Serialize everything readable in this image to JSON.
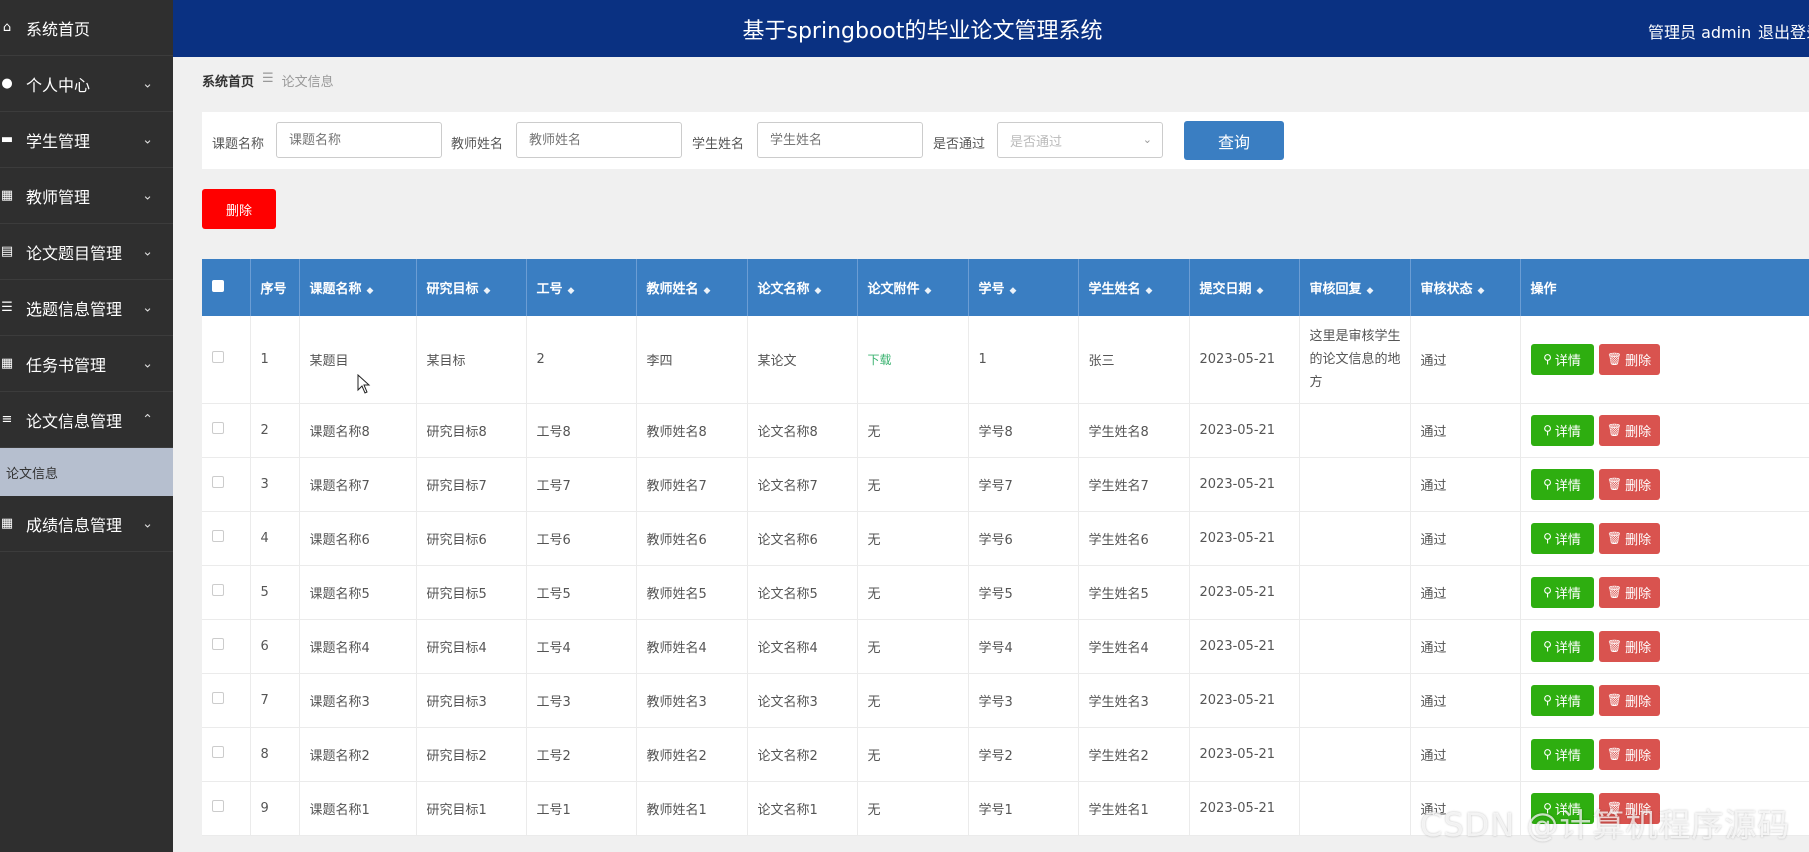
{
  "header": {
    "title": "基于springboot的毕业论文管理系统",
    "user": "管理员 admin",
    "logout": "退出登录"
  },
  "sidebar": {
    "items": [
      {
        "label": "系统首页",
        "icon": "home-icon",
        "has_chevron": false
      },
      {
        "label": "个人中心",
        "icon": "user-icon",
        "has_chevron": true,
        "chevron": "⌄"
      },
      {
        "label": "学生管理",
        "icon": "briefcase-icon",
        "has_chevron": true,
        "chevron": "⌄"
      },
      {
        "label": "教师管理",
        "icon": "grid-icon",
        "has_chevron": true,
        "chevron": "⌄"
      },
      {
        "label": "论文题目管理",
        "icon": "clipboard-icon",
        "has_chevron": true,
        "chevron": "⌄"
      },
      {
        "label": "选题信息管理",
        "icon": "list-icon",
        "has_chevron": true,
        "chevron": "⌄"
      },
      {
        "label": "任务书管理",
        "icon": "grid-icon",
        "has_chevron": true,
        "chevron": "⌄"
      },
      {
        "label": "论文信息管理",
        "icon": "sliders-icon",
        "has_chevron": true,
        "chevron": "⌃",
        "expanded": true
      },
      {
        "label": "成绩信息管理",
        "icon": "grid-icon",
        "has_chevron": true,
        "chevron": "⌄"
      }
    ],
    "sub_item": "论文信息"
  },
  "breadcrumb": {
    "home": "系统首页",
    "sep": "☰",
    "current": "论文信息"
  },
  "search": {
    "topic_label": "课题名称",
    "topic_placeholder": "课题名称",
    "teacher_label": "教师姓名",
    "teacher_placeholder": "教师姓名",
    "student_label": "学生姓名",
    "student_placeholder": "学生姓名",
    "pass_label": "是否通过",
    "pass_placeholder": "是否通过",
    "button": "查询"
  },
  "delete_button": "删除",
  "table": {
    "columns": [
      "序号",
      "课题名称",
      "研究目标",
      "工号",
      "教师姓名",
      "论文名称",
      "论文附件",
      "学号",
      "学生姓名",
      "提交日期",
      "审核回复",
      "审核状态",
      "操作"
    ],
    "detail_label": "详情",
    "delete_label": "删除",
    "rows": [
      {
        "no": "1",
        "topic": "某题目",
        "goal": "某目标",
        "job_no": "2",
        "teacher": "李四",
        "thesis": "某论文",
        "attachment": "下载",
        "student_no": "1",
        "student": "张三",
        "date": "2023-05-21",
        "reply": "这里是审核学生的论文信息的地方",
        "status": "通过"
      },
      {
        "no": "2",
        "topic": "课题名称8",
        "goal": "研究目标8",
        "job_no": "工号8",
        "teacher": "教师姓名8",
        "thesis": "论文名称8",
        "attachment": "无",
        "student_no": "学号8",
        "student": "学生姓名8",
        "date": "2023-05-21",
        "reply": "",
        "status": "通过"
      },
      {
        "no": "3",
        "topic": "课题名称7",
        "goal": "研究目标7",
        "job_no": "工号7",
        "teacher": "教师姓名7",
        "thesis": "论文名称7",
        "attachment": "无",
        "student_no": "学号7",
        "student": "学生姓名7",
        "date": "2023-05-21",
        "reply": "",
        "status": "通过"
      },
      {
        "no": "4",
        "topic": "课题名称6",
        "goal": "研究目标6",
        "job_no": "工号6",
        "teacher": "教师姓名6",
        "thesis": "论文名称6",
        "attachment": "无",
        "student_no": "学号6",
        "student": "学生姓名6",
        "date": "2023-05-21",
        "reply": "",
        "status": "通过"
      },
      {
        "no": "5",
        "topic": "课题名称5",
        "goal": "研究目标5",
        "job_no": "工号5",
        "teacher": "教师姓名5",
        "thesis": "论文名称5",
        "attachment": "无",
        "student_no": "学号5",
        "student": "学生姓名5",
        "date": "2023-05-21",
        "reply": "",
        "status": "通过"
      },
      {
        "no": "6",
        "topic": "课题名称4",
        "goal": "研究目标4",
        "job_no": "工号4",
        "teacher": "教师姓名4",
        "thesis": "论文名称4",
        "attachment": "无",
        "student_no": "学号4",
        "student": "学生姓名4",
        "date": "2023-05-21",
        "reply": "",
        "status": "通过"
      },
      {
        "no": "7",
        "topic": "课题名称3",
        "goal": "研究目标3",
        "job_no": "工号3",
        "teacher": "教师姓名3",
        "thesis": "论文名称3",
        "attachment": "无",
        "student_no": "学号3",
        "student": "学生姓名3",
        "date": "2023-05-21",
        "reply": "",
        "status": "通过"
      },
      {
        "no": "8",
        "topic": "课题名称2",
        "goal": "研究目标2",
        "job_no": "工号2",
        "teacher": "教师姓名2",
        "thesis": "论文名称2",
        "attachment": "无",
        "student_no": "学号2",
        "student": "学生姓名2",
        "date": "2023-05-21",
        "reply": "",
        "status": "通过"
      },
      {
        "no": "9",
        "topic": "课题名称1",
        "goal": "研究目标1",
        "job_no": "工号1",
        "teacher": "教师姓名1",
        "thesis": "论文名称1",
        "attachment": "无",
        "student_no": "学号1",
        "student": "学生姓名1",
        "date": "2023-05-21",
        "reply": "",
        "status": "通过"
      }
    ]
  },
  "watermark": "CSDN @计算机程序源码",
  "colors": {
    "header_bg": "#0a3182",
    "sidebar_bg": "#2f2f2f",
    "table_head": "#3a7ec2",
    "detail_btn": "#2eae10",
    "delete_btn": "#d9534f",
    "top_delete": "#ff0000"
  }
}
